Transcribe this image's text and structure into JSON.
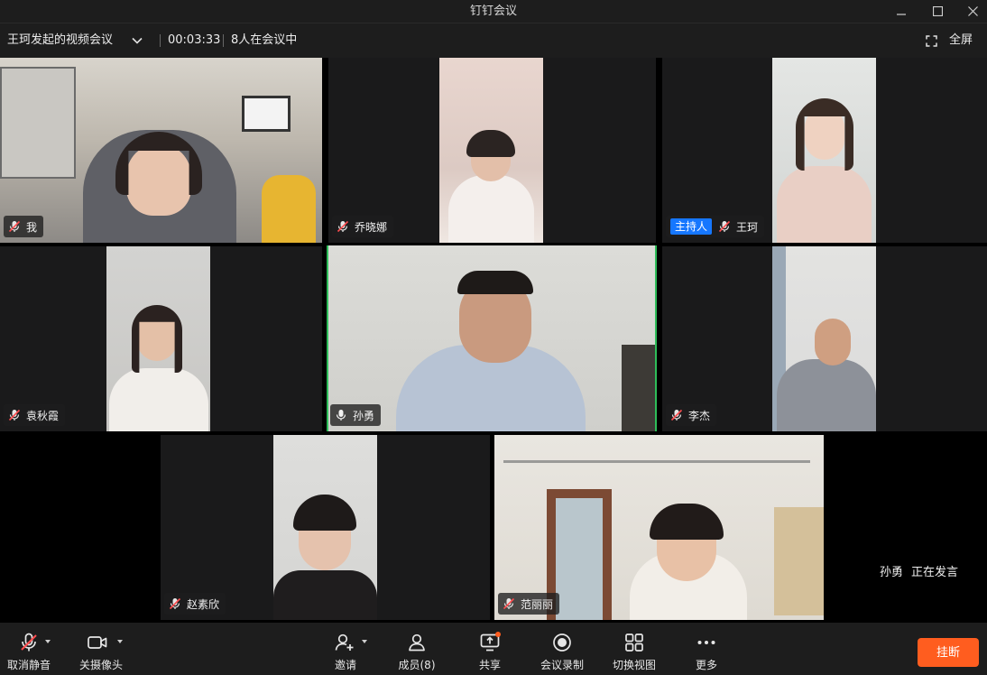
{
  "window": {
    "title": "钉钉会议"
  },
  "info": {
    "meeting_name": "王珂发起的视频会议",
    "timer": "00:03:33",
    "participants_text": "8人在会议中",
    "fullscreen_label": "全屏"
  },
  "participants": [
    {
      "name": "我"
    },
    {
      "name": "乔晓娜"
    },
    {
      "name": "王珂",
      "badge": "主持人"
    },
    {
      "name": "袁秋霞"
    },
    {
      "name": "孙勇"
    },
    {
      "name": "李杰"
    },
    {
      "name": "赵素欣"
    },
    {
      "name": "范丽丽"
    }
  ],
  "speaking": {
    "name": "孙勇",
    "status": "正在发言"
  },
  "toolbar": {
    "unmute": "取消静音",
    "camera": "关摄像头",
    "invite": "邀请",
    "members": "成员(8)",
    "share": "共享",
    "record": "会议录制",
    "layout": "切换视图",
    "more": "更多",
    "hangup": "挂断"
  },
  "colors": {
    "accent_green": "#2ebd59",
    "hangup": "#ff5d1f",
    "host_badge": "#1677ff",
    "share_dot": "#ff5d1f"
  }
}
